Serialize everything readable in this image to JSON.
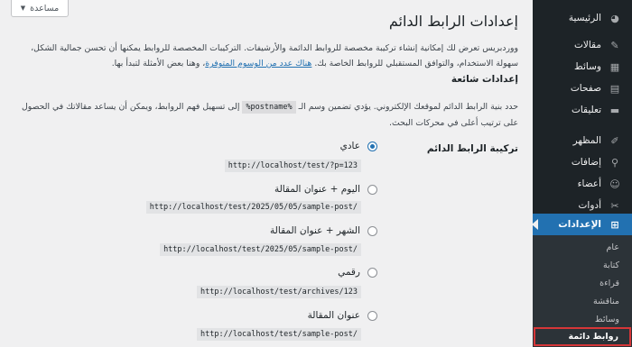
{
  "help_button": {
    "label": "مساعدة"
  },
  "sidebar": {
    "items": [
      {
        "label": "الرئيسية",
        "icon": "dashboard-icon",
        "glyph": "◕"
      },
      {
        "label": "مقالات",
        "icon": "pin-icon",
        "glyph": "✎"
      },
      {
        "label": "وسائط",
        "icon": "media-icon",
        "glyph": "▦"
      },
      {
        "label": "صفحات",
        "icon": "pages-icon",
        "glyph": "▤"
      },
      {
        "label": "تعليقات",
        "icon": "comments-icon",
        "glyph": "▬"
      },
      {
        "label": "المظهر",
        "icon": "brush-icon",
        "glyph": "✐"
      },
      {
        "label": "إضافات",
        "icon": "plugins-icon",
        "glyph": "⚲"
      },
      {
        "label": "أعضاء",
        "icon": "users-icon",
        "glyph": "☺"
      },
      {
        "label": "أدوات",
        "icon": "tools-icon",
        "glyph": "✂"
      },
      {
        "label": "الإعدادات",
        "icon": "settings-icon",
        "glyph": "⊞"
      }
    ],
    "submenu": [
      {
        "label": "عام"
      },
      {
        "label": "كتابة"
      },
      {
        "label": "قراءة"
      },
      {
        "label": "مناقشة"
      },
      {
        "label": "وسائط"
      },
      {
        "label": "روابط دائمة"
      }
    ]
  },
  "main": {
    "title": "إعدادات الرابط الدائم",
    "intro_before_link": "ووردبريس تعرض لك إمكانية إنشاء تركيبة مخصصة للروابط الدائمة والأرشيفات. التركيبات المخصصة للروابط يمكنها أن تحسن جمالية الشكل، سهولة الاستخدام، والتوافق المستقبلي للروابط الخاصة بك.",
    "intro_link": "هناك عدد من الوسوم المتوفرة",
    "intro_after_link": "، وهنا بعض الأمثلة لتبدأ بها.",
    "common_settings_title": "إعدادات شائعة",
    "common_desc_before": "حدد بنية الرابط الدائم لموقعك الإلكتروني. يؤدي تضمين وسم الـ",
    "common_desc_tag": "%postname%",
    "common_desc_after": "إلى تسهيل فهم الروابط، ويمكن أن يساعد مقالاتك في الحصول على ترتيب أعلى في محركات البحث.",
    "structure_label": "تركيبة الرابط الدائم",
    "options": [
      {
        "label": "عادي",
        "sample": "http://localhost/test/?p=123",
        "checked": true
      },
      {
        "label": "اليوم + عنوان المقالة",
        "sample": "http://localhost/test/2025/05/05/sample-post/",
        "checked": false
      },
      {
        "label": "الشهر + عنوان المقالة",
        "sample": "http://localhost/test/2025/05/sample-post/",
        "checked": false
      },
      {
        "label": "رقمي",
        "sample": "http://localhost/test/archives/123",
        "checked": false
      },
      {
        "label": "عنوان المقالة",
        "sample": "http://localhost/test/sample-post/",
        "checked": false
      }
    ]
  },
  "colors": {
    "sidebar_bg": "#1d2327",
    "submenu_bg": "#2c3338",
    "accent": "#2271b1",
    "highlight_border": "#d63638",
    "page_bg": "#f0f0f1"
  }
}
